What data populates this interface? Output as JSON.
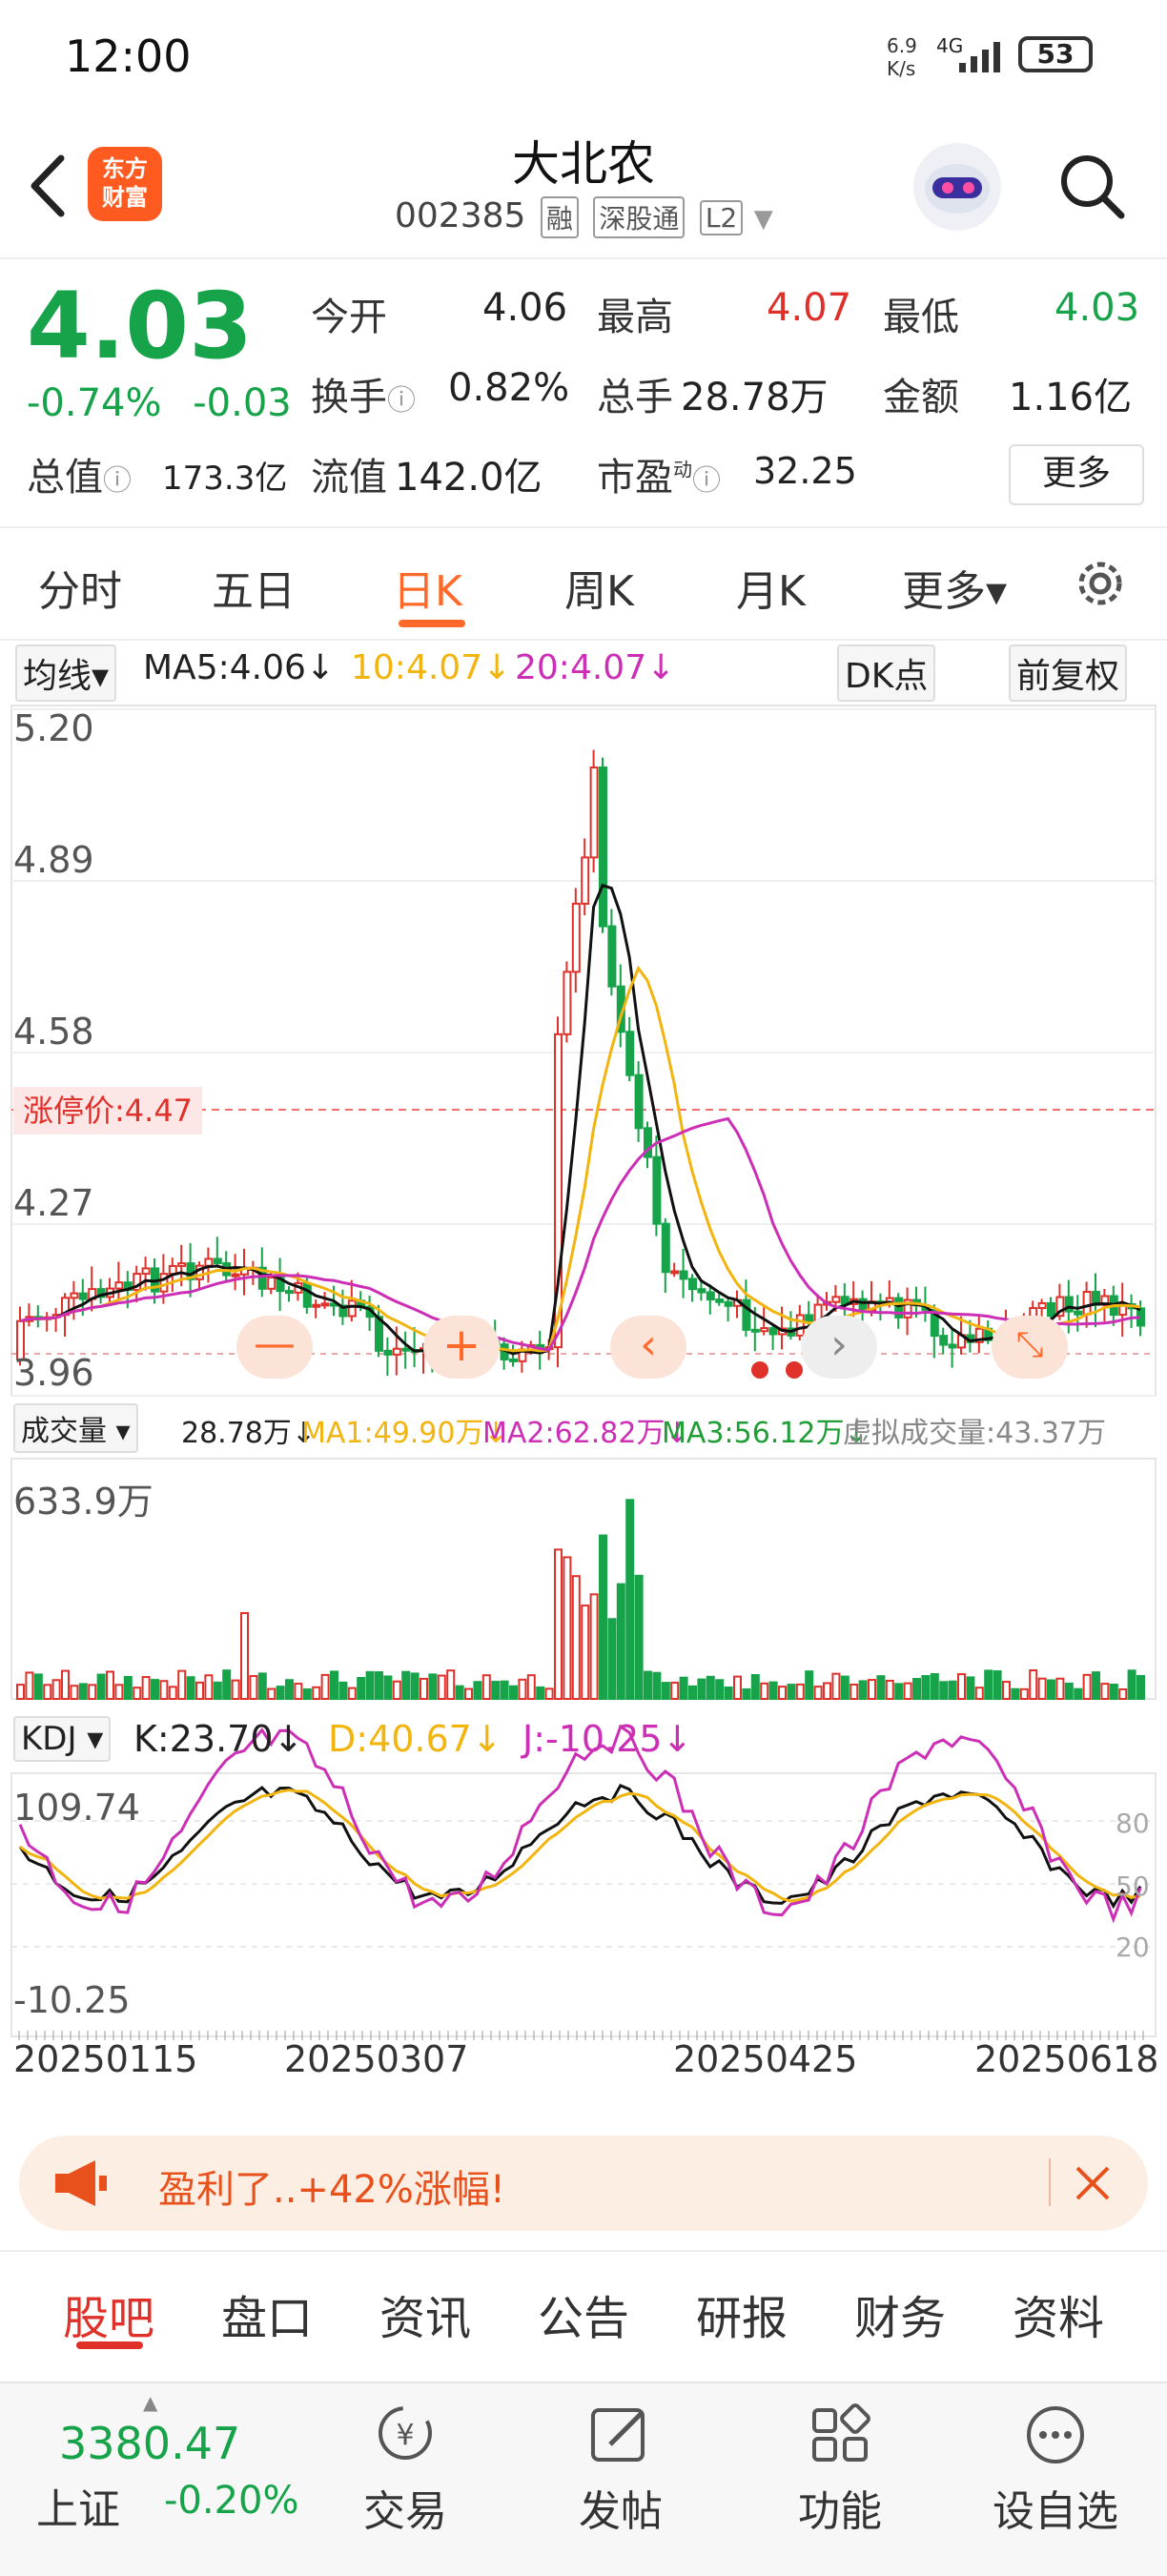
{
  "status": {
    "time": "12:00",
    "net_speed_top": "6.9",
    "net_speed_bottom": "K/s",
    "network": "4G",
    "battery": "53"
  },
  "header": {
    "title": "大北农",
    "code": "002385",
    "tags": [
      "融",
      "深股通",
      "L2"
    ],
    "logo_line1": "东方",
    "logo_line2": "财富"
  },
  "quote": {
    "price": "4.03",
    "change_pct": "-0.74%",
    "change": "-0.03",
    "open_label": "今开",
    "open": "4.06",
    "high_label": "最高",
    "high": "4.07",
    "low_label": "最低",
    "low": "4.03",
    "turnover_label": "换手",
    "turnover": "0.82%",
    "volume_label": "总手",
    "volume": "28.78万",
    "amount_label": "金额",
    "amount": "1.16亿",
    "total_value_label": "总值",
    "total_value": "173.3亿",
    "float_value_label": "流值",
    "float_value": "142.0亿",
    "pe_label": "市盈",
    "pe_sup": "动",
    "pe": "32.25",
    "more": "更多"
  },
  "tabs": [
    "分时",
    "五日",
    "日K",
    "周K",
    "月K",
    "更多▾"
  ],
  "ma": {
    "selector": "均线▾",
    "ma5": "MA5:4.06↓",
    "ma10": "10:4.07↓",
    "ma20": "20:4.07↓",
    "dk": "DK点",
    "adjust": "前复权"
  },
  "price_axis": [
    "5.20",
    "4.89",
    "4.58",
    "4.27",
    "3.96"
  ],
  "limit_price": "涨停价:4.47",
  "volume": {
    "selector": "成交量 ▾",
    "vol": "28.78万↓",
    "ma1": "MA1:49.90万↓",
    "ma2": "MA2:62.82万↓",
    "ma3": "MA3:56.12万↓",
    "virtual": "虚拟成交量:43.37万",
    "axis_top": "633.9万"
  },
  "kdj": {
    "selector": "KDJ ▾",
    "k": "K:23.70↓",
    "d": "D:40.67↓",
    "j": "J:-10.25↓",
    "axis_top": "109.74",
    "axis_bottom": "-10.25",
    "right_ticks": [
      "80",
      "50",
      "20"
    ]
  },
  "dates": [
    "20250115",
    "20250307",
    "20250425",
    "20250618"
  ],
  "banner": {
    "text": "盈利了..+42%涨幅!"
  },
  "bottom_tabs": [
    "股吧",
    "盘口",
    "资讯",
    "公告",
    "研报",
    "财务",
    "资料"
  ],
  "footer": {
    "index_value": "3380.47",
    "index_name": "上证",
    "index_change": "-0.20%",
    "items": [
      "交易",
      "发帖",
      "功能",
      "设自选"
    ]
  },
  "colors": {
    "up": "#e0302a",
    "down": "#16a34a",
    "accent": "#ff6a2a",
    "ma10": "#f2b50f",
    "ma20": "#cc2fb5"
  }
}
